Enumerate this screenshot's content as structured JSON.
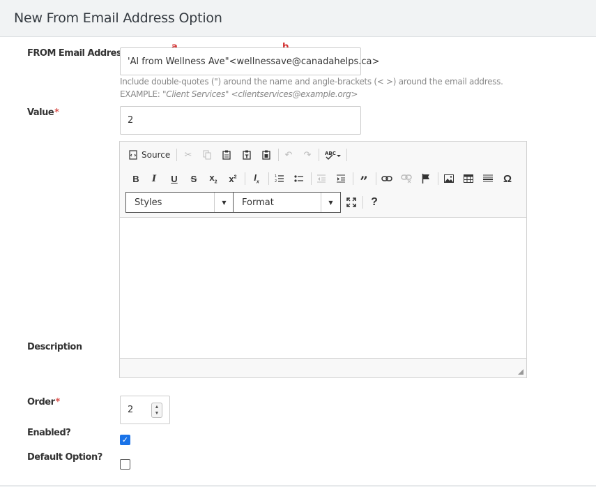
{
  "page": {
    "title": "New From Email Address Option"
  },
  "from_email": {
    "label": "FROM Email Address",
    "value": "'Al from Wellness Ave\"<wellnessave@canadahelps.ca>",
    "marker_a": "a",
    "marker_b": "b",
    "help_line1": "Include double-quotes (\") around the name and angle-brackets (< >) around the email address.",
    "help_example_prefix": "EXAMPLE: ",
    "help_example": "\"Client Services\" <clientservices@example.org>"
  },
  "value_field": {
    "label": "Value",
    "required_mark": "*",
    "value": "2"
  },
  "editor": {
    "source_label": "Source",
    "styles_label": "Styles",
    "format_label": "Format"
  },
  "description": {
    "label": "Description"
  },
  "order": {
    "label": "Order",
    "required_mark": "*",
    "value": "2"
  },
  "enabled": {
    "label": "Enabled?",
    "checked": true
  },
  "default_option": {
    "label": "Default Option?",
    "checked": false
  },
  "colors": {
    "accent": "#1a73e8",
    "required": "#d9534f",
    "marker": "#d32f2f"
  }
}
